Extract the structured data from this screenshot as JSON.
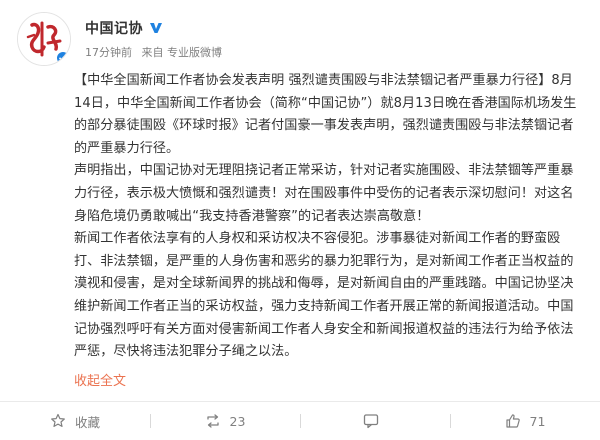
{
  "account": {
    "name": "中国记协",
    "time": "17分钟前",
    "source": "来自 专业版微博"
  },
  "post": {
    "paragraphs": [
      "【中华全国新闻工作者协会发表声明 强烈谴责围殴与非法禁锢记者严重暴力行径】8月14日，中华全国新闻工作者协会（简称“中国记协”）就8月13日晚在香港国际机场发生的部分暴徒围殴《环球时报》记者付国豪一事发表声明，强烈谴责围殴与非法禁锢记者的严重暴力行径。",
      "声明指出，中国记协对无理阻挠记者正常采访，针对记者实施围殴、非法禁锢等严重暴力行径，表示极大愤慨和强烈谴责！对在围殴事件中受伤的记者表示深切慰问！对这名身陷危境仍勇敢喊出“我支持香港警察”的记者表达崇高敬意！",
      "新闻工作者依法享有的人身权和采访权决不容侵犯。涉事暴徒对新闻工作者的野蛮殴打、非法禁锢，是严重的人身伤害和恶劣的暴力犯罪行为，是对新闻工作者正当权益的漠视和侵害，是对全球新闻界的挑战和侮辱，是对新闻自由的严重践踏。中国记协坚决维护新闻工作者正当的采访权益，强力支持新闻工作者开展正常的新闻报道活动。中国记协强烈呼吁有关方面对侵害新闻工作者人身安全和新闻报道权益的违法行为给予依法严惩，尽快将违法犯罪分子绳之以法。"
    ],
    "collapse_label": "收起全文"
  },
  "actions": {
    "favorite_label": "收藏",
    "repost_count": "23",
    "comment_label": "",
    "like_count": "71"
  },
  "colors": {
    "link_orange": "#eb7350",
    "logo_red": "#c0282d",
    "verify_blue": "#1f82e0",
    "meta_gray": "#808080"
  }
}
